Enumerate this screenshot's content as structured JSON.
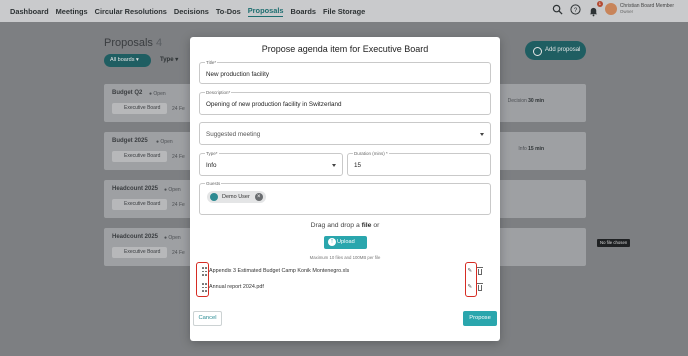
{
  "nav": {
    "items": [
      "Dashboard",
      "Meetings",
      "Circular Resolutions",
      "Decisions",
      "To-Dos",
      "Proposals",
      "Boards",
      "File Storage"
    ],
    "active_index": 5,
    "notification_count": "1",
    "user_name": "Christian Board Member",
    "user_sub": "Owner"
  },
  "background": {
    "heading": "Proposals",
    "count": "4",
    "filter_label": "All boards ▾",
    "type_label": "Type ▾",
    "add_button": "Add proposal",
    "cards": [
      {
        "title": "Budget Q2",
        "status": "● Open",
        "board": "Executive Board",
        "date": "24 Fe",
        "right_label": "Decision",
        "right_value": "30 min"
      },
      {
        "title": "Budget 2025",
        "status": "● Open",
        "board": "Executive Board",
        "date": "24 Fe",
        "right_label": "Info",
        "right_value": "15 min"
      },
      {
        "title": "Headcount 2025",
        "status": "● Open",
        "board": "Executive Board",
        "date": "24 Fe",
        "right_label": "",
        "right_value": ""
      },
      {
        "title": "Headcount 2025",
        "status": "● Open",
        "board": "Executive Board",
        "date": "24 Fe",
        "right_label": "",
        "right_value": ""
      }
    ],
    "tooltip": "No file chosen"
  },
  "modal": {
    "title": "Propose agenda item for Executive Board",
    "title_field": {
      "label": "Title*",
      "value": "New production facility"
    },
    "description_field": {
      "label": "Description*",
      "value": "Opening of new production facility in Switzerland"
    },
    "meeting_field": {
      "placeholder": "Suggested meeting"
    },
    "type_field": {
      "label": "Type*",
      "value": "Info"
    },
    "duration_field": {
      "label": "Duration (mins) *",
      "value": "15"
    },
    "guests_field": {
      "label": "Guests",
      "chips": [
        "Demo User"
      ]
    },
    "dropzone": {
      "text_before": "Drag and drop a ",
      "text_bold": "file",
      "text_after": " or",
      "upload_label": "Upload",
      "hint": "Maximum 10 files and 100MB per file"
    },
    "files": [
      {
        "name": "Appendix 3 Estimated Budget Camp Konik Montenegro.xls"
      },
      {
        "name": "Annual report 2024.pdf"
      }
    ],
    "cancel_label": "Cancel",
    "propose_label": "Propose"
  },
  "colors": {
    "accent": "#2aa6ad",
    "highlight": "#d62c23",
    "overlay": "#7d7f82"
  }
}
